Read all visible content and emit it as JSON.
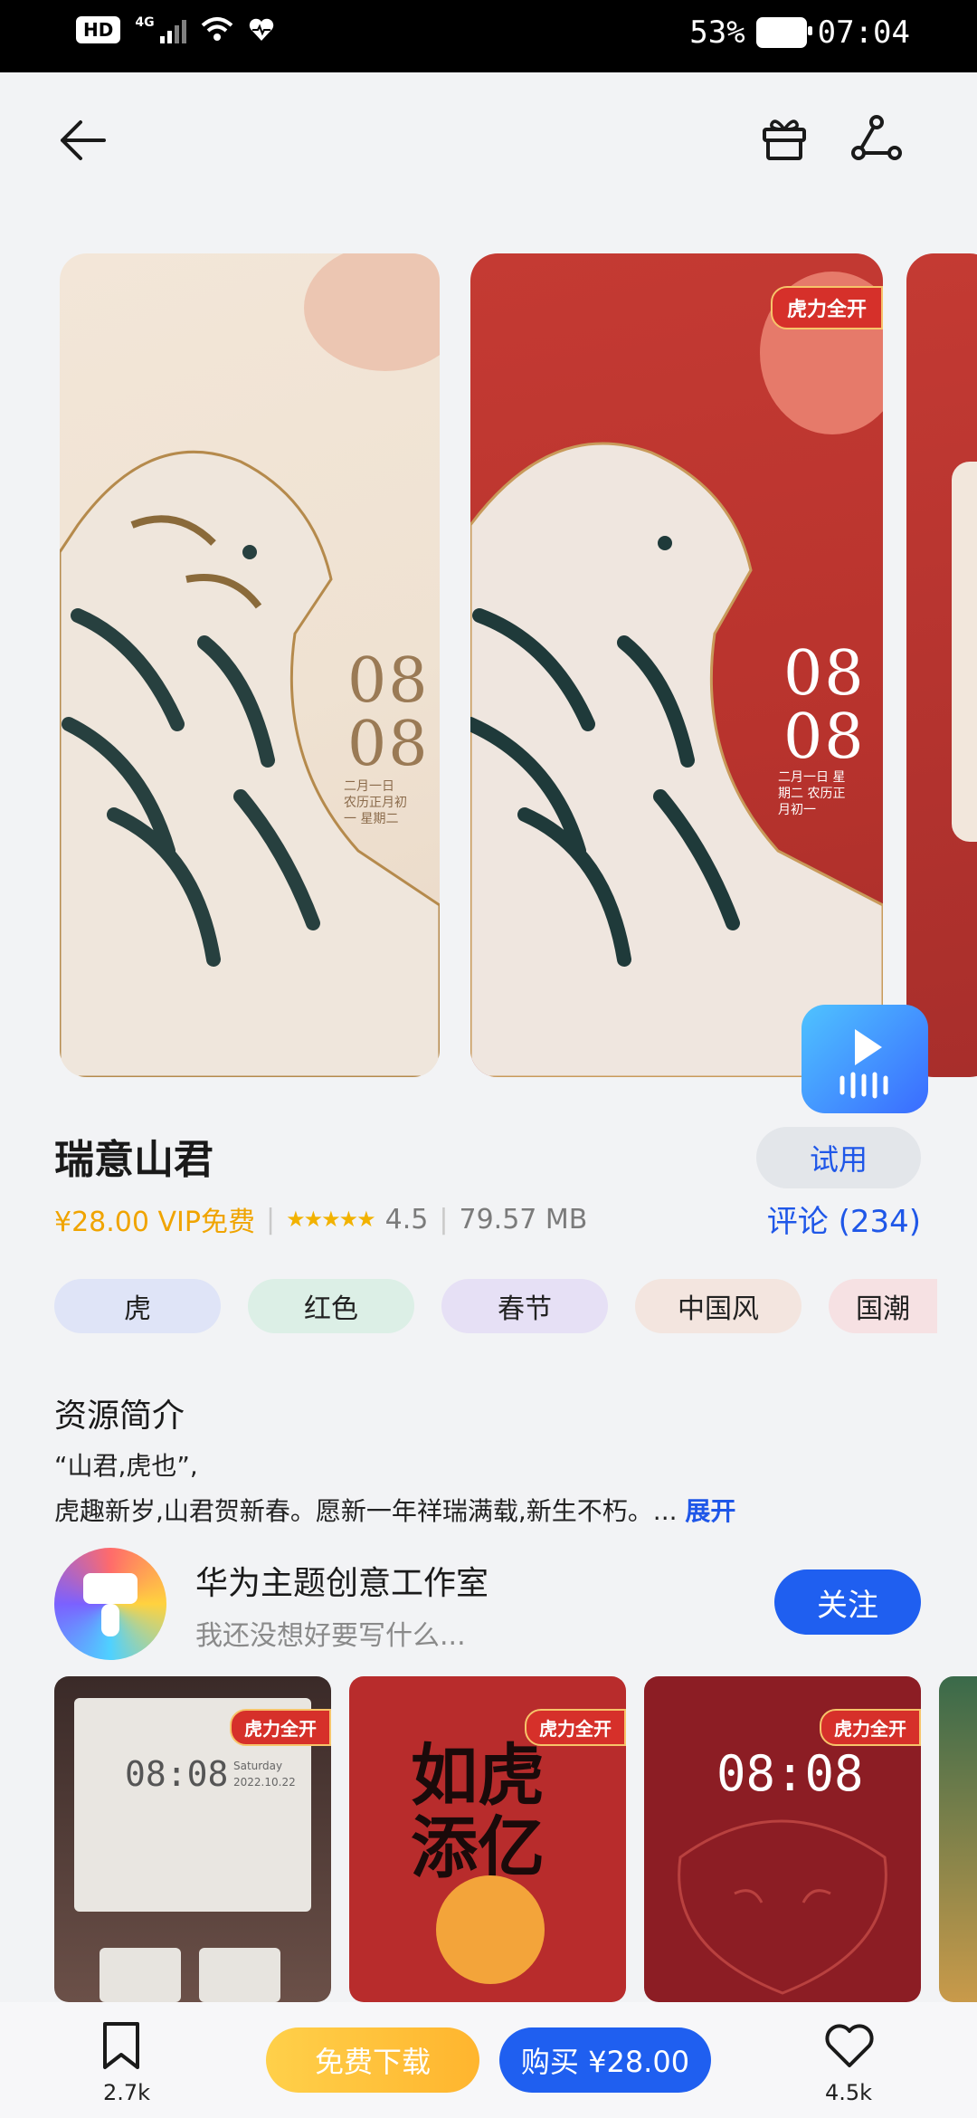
{
  "status_bar": {
    "hd": "HD",
    "network": "4G",
    "battery": "53%",
    "time": "07:04"
  },
  "carousel": {
    "slide1": {
      "time_line1": "08",
      "time_line2": "08",
      "date_line": "二月一日 农历正月初一 星期二"
    },
    "slide2": {
      "badge": "虎力全开",
      "time_line1": "08",
      "time_line2": "08",
      "date_line": "二月一日 星期二 农历正月初一"
    }
  },
  "theme": {
    "title": "瑞意山君",
    "try_label": "试用",
    "price": "¥28.00 VIP免费",
    "rating": "4.5",
    "size": "79.57 MB",
    "reviews_label": "评论 (234)"
  },
  "tags": [
    {
      "label": "虎",
      "color": "#dfe4f7"
    },
    {
      "label": "红色",
      "color": "#dcefe6"
    },
    {
      "label": "春节",
      "color": "#e6e0f5"
    },
    {
      "label": "中国风",
      "color": "#f3e5df"
    },
    {
      "label": "国潮",
      "color": "#f6e1e3"
    }
  ],
  "description": {
    "section_title": "资源简介",
    "line1": "“山君,虎也”,",
    "line2": "虎趣新岁,山君贺新春。愿新一年祥瑞满载,新生不朽。...",
    "expand": "展开"
  },
  "author": {
    "name": "华为主题创意工作室",
    "bio": "我还没想好要写什么...",
    "follow_label": "关注"
  },
  "related": [
    {
      "badge": "虎力全开",
      "clock": "08:08",
      "weekday": "Saturday",
      "date": "2022.10.22"
    },
    {
      "badge": "虎力全开",
      "art_text": "如虎添亿"
    },
    {
      "badge": "虎力全开",
      "clock": "08:08"
    }
  ],
  "bottom_bar": {
    "bookmark_count": "2.7k",
    "free_download": "免费下载",
    "buy": "购买 ¥28.00",
    "like_count": "4.5k"
  }
}
